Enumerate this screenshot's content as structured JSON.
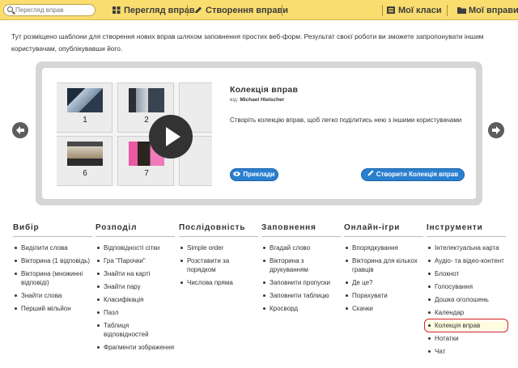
{
  "topnav": {
    "search_placeholder": "Перегляд вправ",
    "items": [
      {
        "label": "Перегляд вправ",
        "icon": "grid-icon"
      },
      {
        "label": "Створення вправи",
        "icon": "pencil-icon"
      },
      {
        "label": "Мої класи",
        "icon": "class-list-icon"
      },
      {
        "label": "Мої вправи",
        "icon": "folder-icon"
      }
    ]
  },
  "intro": "Тут розміщено шаблони для створення нових вправ шляхом заповнення простих веб-форм. Результат своєї роботи ви зможете запропонувати іншим користувачам, опублікувавши його.",
  "carousel": {
    "title": "Колекція вправ",
    "author_prefix": "від:",
    "author": "Michael Hielscher",
    "description": "Створіть колекцію вправ, щоб легко поділитись нею з іншими користувачами",
    "thumbnails": [
      "1",
      "2",
      "6",
      "7"
    ],
    "examples_button": "Приклади",
    "create_button": "Створити Колекція вправ"
  },
  "categories": [
    {
      "heading": "Вибір",
      "items": [
        "Виділити слова",
        "Вікторина (1 відповідь)",
        "Вікторина (множинні відповіді)",
        "Знайти слова",
        "Перший мільйон"
      ]
    },
    {
      "heading": "Розподіл",
      "items": [
        "Відповідності сітки",
        "Гра \"Парочки\"",
        "Знайти на карті",
        "Знайти пару",
        "Класифікація",
        "Пазл",
        "Таблиця відповідностей",
        "Фрагменти зображення"
      ]
    },
    {
      "heading": "Послідовність",
      "items": [
        "Simple order",
        "Розставити за порядком",
        "Числова пряма"
      ]
    },
    {
      "heading": "Заповнення",
      "items": [
        "Вгадай слово",
        "Вікторина з друкуванням",
        "Заповнити пропуски",
        "Заповнити таблицю",
        "Кросворд"
      ]
    },
    {
      "heading": "Онлайн-ігри",
      "items": [
        "Впорядкування",
        "Вікторина для кількох гравців",
        "Де це?",
        "Порахувати",
        "Скачки"
      ]
    },
    {
      "heading": "Інструменти",
      "items": [
        "Інтелектуальна карта",
        "Аудіо- та відео-контент",
        "Блокнот",
        "Голосування",
        "Дошка оголошень",
        "Календар",
        "Колекція вправ",
        "Нотатки",
        "Чат"
      ]
    }
  ],
  "highlighted_item": "Колекція вправ",
  "colors": {
    "topbar": "#f9dd6e",
    "button_blue": "#2a7fcf",
    "highlight_border": "#d42020"
  }
}
